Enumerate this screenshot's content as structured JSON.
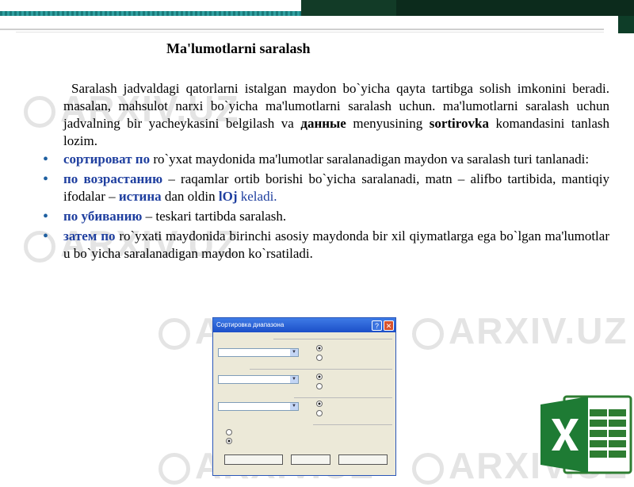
{
  "title": "Ma'lumotlarni saralash",
  "intro": {
    "p1": "Saralash jadvaldagi qatorlarni istalgan maydon bo`yicha qayta tartibga solish imkonini beradi. masalan, mahsulot narxi bo`yicha ma'lumotlarni saralash uchun. ma'lumotlarni saralash uchun jadvalning bir yacheykasini belgilash va ",
    "menu1": "данные",
    "p2": " menyusining ",
    "menu2": "sortirovka",
    "p3": " komandasini tanlash lozim."
  },
  "bullets": [
    {
      "term": "сортироват по",
      "text": " ro`yxat maydonida  ma'lumotlar saralanadigan maydon va saralash turi  tanlanadi:"
    },
    {
      "term": "по возрастанию",
      "text": "  – raqamlar ortib borishi bo`yicha saralanadi, matn – alifbo tartibida, mantiqiy ifodalar – ",
      "term2": "истина",
      "text2": " dan oldin ",
      "term3": "lOj",
      "text3": " keladi."
    },
    {
      "term": "по убиванию",
      "text": " – teskari tartibda saralash."
    },
    {
      "term": "затем по",
      "text": " ro`yxati maydonida birinchi asosiy maydonda bir xil qiymatlarga ega bo`lgan ma'lumotlar u bo`yicha saralanadigan  maydon ko`rsatiladi."
    }
  ],
  "bullet_symbol": "•",
  "dialog": {
    "title": "Сортировка диапазона",
    "help": "?",
    "close": "✕"
  },
  "watermark": "ARXIV.UZ",
  "colors": {
    "accent": "#1f3f9f",
    "top_bar": "#123b27",
    "teal": "#1a7a7a"
  }
}
